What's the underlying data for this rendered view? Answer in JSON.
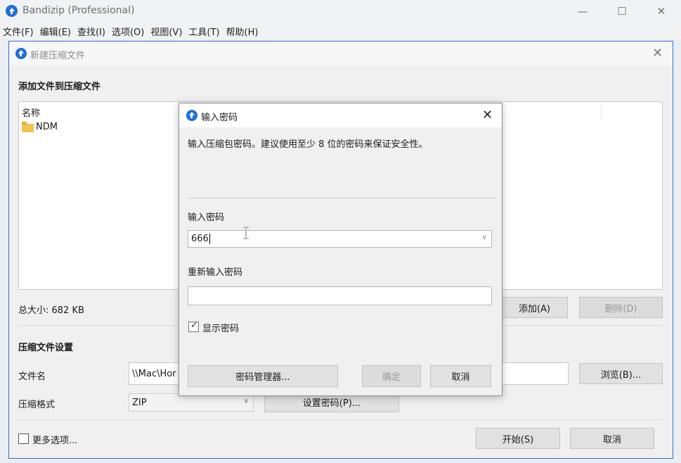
{
  "app": {
    "title": "Bandizip (Professional)",
    "minimize": "—",
    "maximize": "☐",
    "close": "✕"
  },
  "menubar": [
    "文件(F)",
    "编辑(E)",
    "查找(I)",
    "选项(O)",
    "视图(V)",
    "工具(T)",
    "帮助(H)"
  ],
  "new_archive": {
    "title": "新建压缩文件",
    "close": "✕",
    "add_files_heading": "添加文件到压缩文件",
    "list_header_name": "名称",
    "files": [
      {
        "name": "NDM",
        "icon": "folder-icon"
      }
    ],
    "total_size": "总大小: 682 KB",
    "add_button": "添加(A)",
    "remove_button": "删除(D)",
    "settings_heading": "压缩文件设置",
    "filename_label": "文件名",
    "filename_value": "\\\\Mac\\Hor",
    "browse_button": "浏览(B)...",
    "format_label": "压缩格式",
    "format_value": "ZIP",
    "set_password_button": "设置密码(P)...",
    "more_options_label": "更多选项...",
    "start_button": "开始(S)",
    "cancel_button": "取消"
  },
  "password_dialog": {
    "title": "输入密码",
    "close": "✕",
    "description": "输入压缩包密码。建议使用至少 8 位的密码来保证安全性。",
    "password_label": "输入密码",
    "password_value": "666",
    "reenter_label": "重新输入密码",
    "reenter_value": "",
    "show_password_label": "显示密码",
    "show_password_checked": true,
    "password_manager_button": "密码管理器...",
    "ok_button": "确定",
    "cancel_button": "取消"
  },
  "colors": {
    "accent": "#1e6fd8",
    "window_border": "#3b6bc7"
  }
}
